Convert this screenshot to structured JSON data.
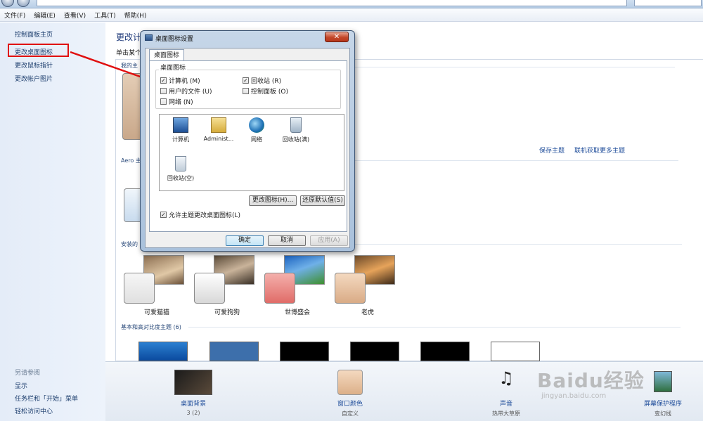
{
  "menu": [
    "文件(F)",
    "编辑(E)",
    "查看(V)",
    "工具(T)",
    "帮助(H)"
  ],
  "left_panel": {
    "links": [
      "控制面板主页",
      "更改桌面图标",
      "更改鼠标指针",
      "更改帐户图片"
    ],
    "see_also_title": "另请参阅",
    "see_also": [
      "显示",
      "任务栏和「开始」菜单",
      "轻松访问中心"
    ]
  },
  "main": {
    "title": "更改计",
    "subtitle": "单击某个",
    "section_my": "我的主",
    "section_aero": "Aero 主",
    "section_installed": "安装的",
    "section_basic": "基本和高对比度主题 (6)",
    "save_theme": "保存主题",
    "get_more_themes": "联机获取更多主题",
    "themes": [
      "可爱猫猫",
      "可爱狗狗",
      "世博盛会",
      "老虎"
    ]
  },
  "bottom": {
    "items": [
      {
        "label": "桌面背景",
        "value": "3 (2)"
      },
      {
        "label": "窗口颜色",
        "value": "自定义"
      },
      {
        "label": "声音",
        "value": "热带大草原"
      },
      {
        "label": "屏幕保护程序",
        "value": "变幻线"
      }
    ]
  },
  "dialog": {
    "title": "桌面图标设置",
    "close_label": "✕",
    "tab": "桌面图标",
    "group_title": "桌面图标",
    "checkboxes": [
      {
        "label": "计算机 (M)",
        "checked": true
      },
      {
        "label": "回收站 (R)",
        "checked": true
      },
      {
        "label": "用户的文件 (U)",
        "checked": false
      },
      {
        "label": "控制面板 (O)",
        "checked": false
      },
      {
        "label": "网络 (N)",
        "checked": false
      }
    ],
    "icons": [
      "计算机",
      "Administ...",
      "网络",
      "回收站(满)",
      "回收站(空)"
    ],
    "change_icon_btn": "更改图标(H)...",
    "restore_default_btn": "还原默认值(S)",
    "allow_themes": {
      "label": "允许主题更改桌面图标(L)",
      "checked": true
    },
    "ok": "确定",
    "cancel": "取消",
    "apply": "应用(A)"
  },
  "watermark": {
    "text": "Baidu经验",
    "url": "jingyan.baidu.com"
  },
  "colors": {
    "annotation_red": "#e00f0f",
    "link_blue": "#1f4d9a"
  }
}
